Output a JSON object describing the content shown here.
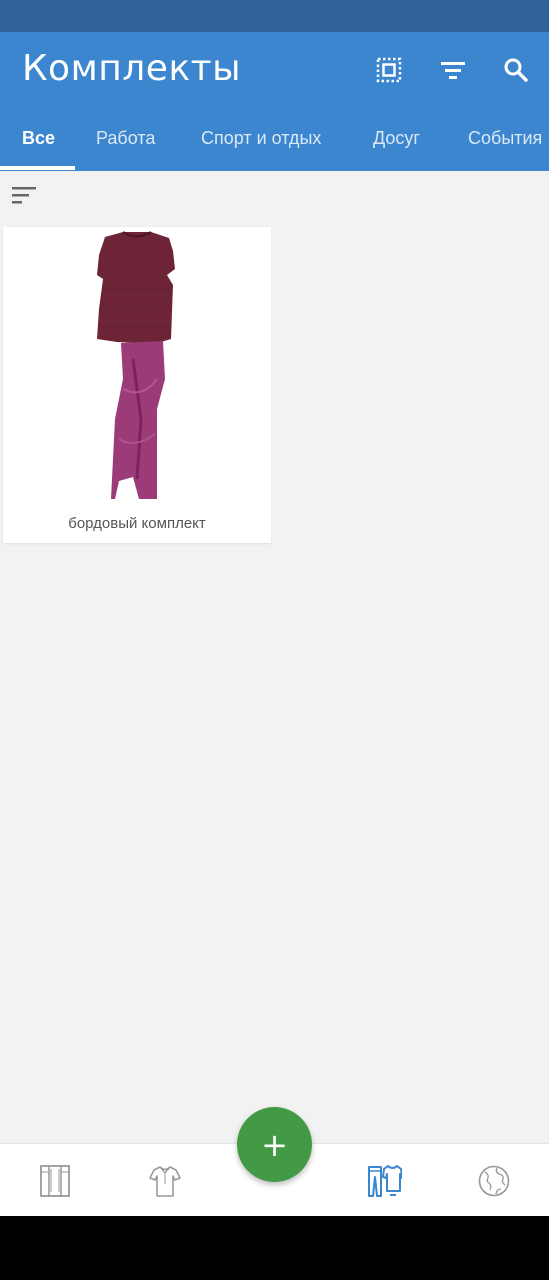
{
  "header": {
    "title": "Комплекты"
  },
  "actions": {
    "select_icon": "select-all-icon",
    "filter_icon": "filter-icon",
    "search_icon": "search-icon"
  },
  "tabs": [
    {
      "label": "Все",
      "active": true
    },
    {
      "label": "Работа"
    },
    {
      "label": "Спорт и отдых"
    },
    {
      "label": "Досуг"
    },
    {
      "label": "События"
    }
  ],
  "outfits": [
    {
      "label": "бордовый комплект"
    }
  ],
  "fab": {
    "label": "+"
  },
  "bottom_nav": [
    {
      "icon": "wardrobe-icon"
    },
    {
      "icon": "shirt-icon"
    },
    {
      "icon": "outfits-icon",
      "active": true
    },
    {
      "icon": "globe-icon"
    }
  ],
  "colors": {
    "app_bar": "#3c86cf",
    "status_bar": "#2f6399",
    "fab": "#439a45",
    "active_nav": "#3c86cf"
  }
}
